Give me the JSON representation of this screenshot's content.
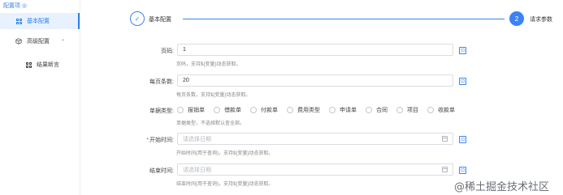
{
  "sidebar": {
    "title": "配置项",
    "title_icon": "target-icon",
    "items": [
      {
        "label": "基本配置",
        "icon": "grid-icon",
        "active": true
      },
      {
        "label": "高级配置",
        "icon": "cube-icon",
        "expanded": true
      },
      {
        "label": "结果断言",
        "icon": "grid-icon"
      }
    ]
  },
  "steps": [
    {
      "label": "基本配置",
      "state": "done",
      "mark": "✓"
    },
    {
      "label": "请求参数",
      "state": "current",
      "mark": "2"
    }
  ],
  "form": {
    "page": {
      "label": "页码:",
      "value": "1",
      "hint": "页码，支持${变量}动态获取。"
    },
    "page_size": {
      "label": "每页条数:",
      "value": "20",
      "hint": "每页条数，支持${变量}动态获取。"
    },
    "doc_type": {
      "label": "单据类型:",
      "options": [
        "报销单",
        "借款单",
        "付款单",
        "费用类型",
        "申请单",
        "合同",
        "项目",
        "收款单"
      ],
      "hint": "单据类型，不选择默认查全部。"
    },
    "start_time": {
      "label": "开始时间:",
      "required": true,
      "placeholder": "请选择日期",
      "hint": "开始时间(用于查询)，支持${变量}动态获取。"
    },
    "end_time": {
      "label": "结束时间:",
      "placeholder": "请选择日期",
      "hint": "结束时间(用于查询)，支持${变量}动态获取。"
    }
  },
  "colors": {
    "accent": "#3b82f6",
    "required": "#e53e3e"
  },
  "watermark": "@稀土掘金技术社区"
}
